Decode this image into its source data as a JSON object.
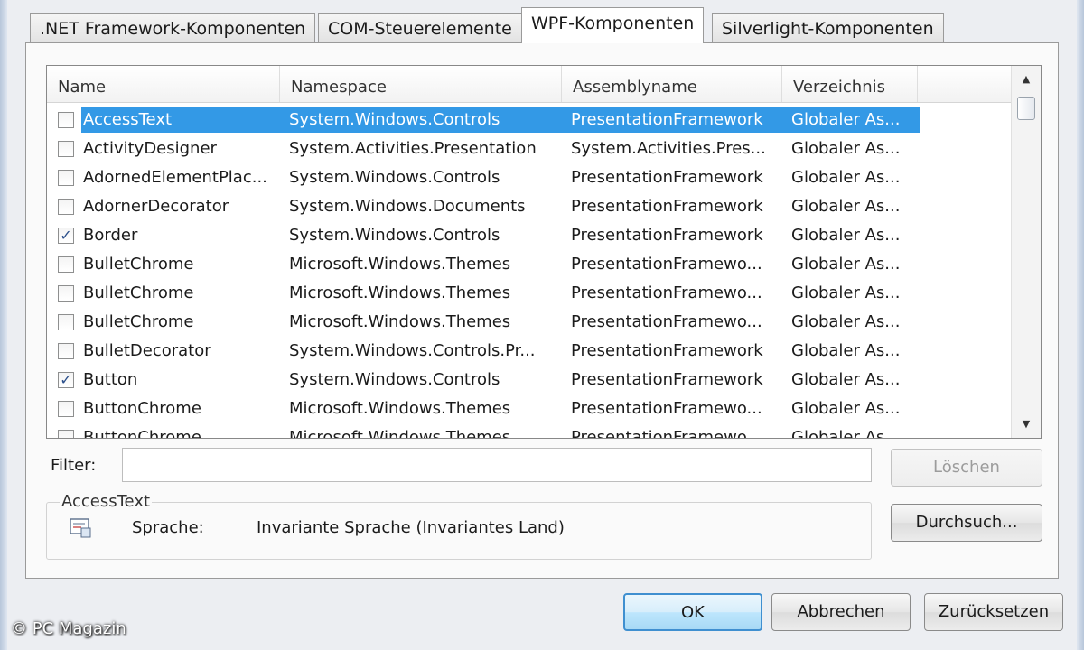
{
  "tabs": [
    {
      "label": ".NET Framework-Komponenten",
      "active": false
    },
    {
      "label": "COM-Steuerelemente",
      "active": false
    },
    {
      "label": "WPF-Komponenten",
      "active": true
    },
    {
      "label": "Silverlight-Komponenten",
      "active": false
    }
  ],
  "list": {
    "columns": [
      "Name",
      "Namespace",
      "Assemblyname",
      "Verzeichnis"
    ],
    "rows": [
      {
        "checked": false,
        "selected": true,
        "name": "AccessText",
        "namespace": "System.Windows.Controls",
        "assembly": "PresentationFramework",
        "dir": "Globaler As..."
      },
      {
        "checked": false,
        "selected": false,
        "name": "ActivityDesigner",
        "namespace": "System.Activities.Presentation",
        "assembly": "System.Activities.Pres...",
        "dir": "Globaler As..."
      },
      {
        "checked": false,
        "selected": false,
        "name": "AdornedElementPlac...",
        "namespace": "System.Windows.Controls",
        "assembly": "PresentationFramework",
        "dir": "Globaler As..."
      },
      {
        "checked": false,
        "selected": false,
        "name": "AdornerDecorator",
        "namespace": "System.Windows.Documents",
        "assembly": "PresentationFramework",
        "dir": "Globaler As..."
      },
      {
        "checked": true,
        "selected": false,
        "name": "Border",
        "namespace": "System.Windows.Controls",
        "assembly": "PresentationFramework",
        "dir": "Globaler As..."
      },
      {
        "checked": false,
        "selected": false,
        "name": "BulletChrome",
        "namespace": "Microsoft.Windows.Themes",
        "assembly": "PresentationFramewo...",
        "dir": "Globaler As..."
      },
      {
        "checked": false,
        "selected": false,
        "name": "BulletChrome",
        "namespace": "Microsoft.Windows.Themes",
        "assembly": "PresentationFramewo...",
        "dir": "Globaler As..."
      },
      {
        "checked": false,
        "selected": false,
        "name": "BulletChrome",
        "namespace": "Microsoft.Windows.Themes",
        "assembly": "PresentationFramewo...",
        "dir": "Globaler As..."
      },
      {
        "checked": false,
        "selected": false,
        "name": "BulletDecorator",
        "namespace": "System.Windows.Controls.Pr...",
        "assembly": "PresentationFramework",
        "dir": "Globaler As..."
      },
      {
        "checked": true,
        "selected": false,
        "name": "Button",
        "namespace": "System.Windows.Controls",
        "assembly": "PresentationFramework",
        "dir": "Globaler As..."
      },
      {
        "checked": false,
        "selected": false,
        "name": "ButtonChrome",
        "namespace": "Microsoft.Windows.Themes",
        "assembly": "PresentationFramewo...",
        "dir": "Globaler As..."
      },
      {
        "checked": false,
        "selected": false,
        "name": "ButtonChrome",
        "namespace": "Microsoft.Windows.Themes",
        "assembly": "PresentationFramewo...",
        "dir": "Globaler As..."
      }
    ]
  },
  "filter": {
    "label": "Filter:",
    "value": "",
    "clear_label": "Löschen"
  },
  "info": {
    "group_title": "AccessText",
    "language_label": "Sprache:",
    "language_value": "Invariante Sprache (Invariantes Land)",
    "browse_label": "Durchsuch..."
  },
  "buttons": {
    "ok": "OK",
    "cancel": "Abbrechen",
    "reset": "Zurücksetzen"
  },
  "watermark": "© PC Magazin",
  "colors": {
    "selection": "#3399e6",
    "accent": "#3f8fd0"
  }
}
